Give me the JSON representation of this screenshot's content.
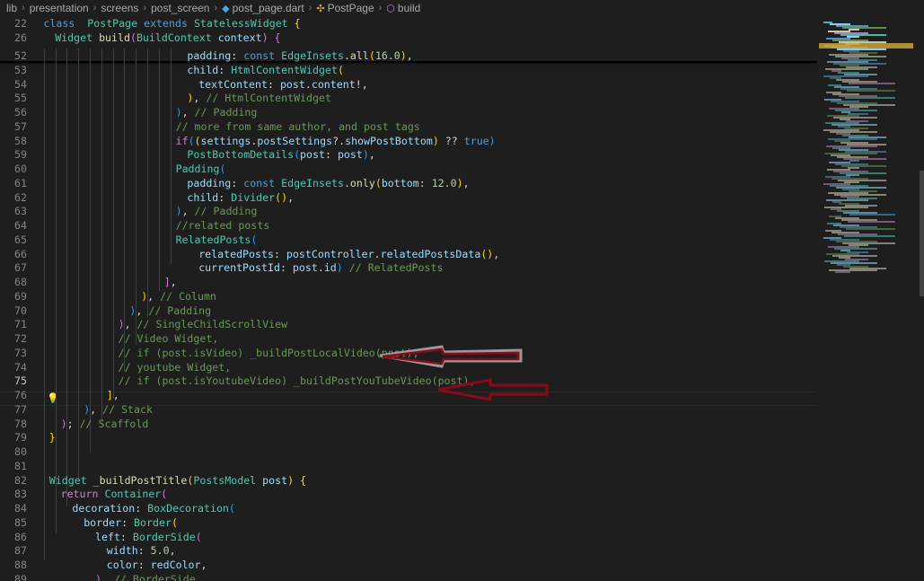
{
  "breadcrumb": {
    "items": [
      "lib",
      "presentation",
      "screens",
      "post_screen",
      "post_page.dart",
      "PostPage",
      "build"
    ]
  },
  "sticky_lines": [
    {
      "num": "22",
      "tokens": [
        [
          "kw",
          "class"
        ],
        [
          "",
          "  "
        ],
        [
          "cls",
          "PostPage"
        ],
        [
          "",
          " "
        ],
        [
          "kw",
          "extends"
        ],
        [
          "",
          " "
        ],
        [
          "cls",
          "StatelessWidget"
        ],
        [
          "",
          " "
        ],
        [
          "p1",
          "{"
        ]
      ]
    },
    {
      "num": "26",
      "tokens": [
        [
          "",
          ""
        ],
        [
          "cls",
          "Widget"
        ],
        [
          "",
          " "
        ],
        [
          "fn",
          "build"
        ],
        [
          "p2",
          "("
        ],
        [
          "cls",
          "BuildContext"
        ],
        [
          "",
          " "
        ],
        [
          "prop",
          "context"
        ],
        [
          "p2",
          ")"
        ],
        [
          "",
          " "
        ],
        [
          "p2",
          "{"
        ]
      ]
    }
  ],
  "lines": [
    {
      "num": "52",
      "indent": 13,
      "tokens": [
        [
          "prop",
          "padding"
        ],
        [
          "",
          ": "
        ],
        [
          "kw",
          "const"
        ],
        [
          "",
          " "
        ],
        [
          "cls",
          "EdgeInsets"
        ],
        [
          "",
          "."
        ],
        [
          "fn",
          "all"
        ],
        [
          "p1",
          "("
        ],
        [
          "num",
          "16.0"
        ],
        [
          "p1",
          ")"
        ],
        [
          "",
          ","
        ]
      ]
    },
    {
      "num": "53",
      "indent": 13,
      "tokens": [
        [
          "prop",
          "child"
        ],
        [
          "",
          ": "
        ],
        [
          "cls",
          "HtmlContentWidget"
        ],
        [
          "p1",
          "("
        ]
      ]
    },
    {
      "num": "54",
      "indent": 14,
      "tokens": [
        [
          "prop",
          "textContent"
        ],
        [
          "",
          ": "
        ],
        [
          "prop",
          "post"
        ],
        [
          "",
          "."
        ],
        [
          "prop",
          "content"
        ],
        [
          "",
          "!,"
        ]
      ]
    },
    {
      "num": "55",
      "indent": 13,
      "tokens": [
        [
          "p1",
          ")"
        ],
        [
          "",
          ", "
        ],
        [
          "cm",
          "// HtmlContentWidget"
        ]
      ]
    },
    {
      "num": "56",
      "indent": 12,
      "tokens": [
        [
          "p3",
          ")"
        ],
        [
          "",
          ", "
        ],
        [
          "cm",
          "// Padding"
        ]
      ]
    },
    {
      "num": "57",
      "indent": 12,
      "tokens": [
        [
          "cm",
          "// more from same author, and post tags"
        ]
      ]
    },
    {
      "num": "58",
      "indent": 12,
      "tokens": [
        [
          "ctl",
          "if"
        ],
        [
          "p3",
          "("
        ],
        [
          "p1",
          "("
        ],
        [
          "prop",
          "settings"
        ],
        [
          "",
          "."
        ],
        [
          "prop",
          "postSettings"
        ],
        [
          "",
          "?."
        ],
        [
          "prop",
          "showPostBottom"
        ],
        [
          "p1",
          ")"
        ],
        [
          "",
          " ?? "
        ],
        [
          "kw",
          "true"
        ],
        [
          "p3",
          ")"
        ]
      ]
    },
    {
      "num": "59",
      "indent": 13,
      "tokens": [
        [
          "cls",
          "PostBottomDetails"
        ],
        [
          "p3",
          "("
        ],
        [
          "prop",
          "post"
        ],
        [
          "",
          ": "
        ],
        [
          "prop",
          "post"
        ],
        [
          "p3",
          ")"
        ],
        [
          "",
          ","
        ]
      ]
    },
    {
      "num": "60",
      "indent": 12,
      "tokens": [
        [
          "cls",
          "Padding"
        ],
        [
          "p3",
          "("
        ]
      ]
    },
    {
      "num": "61",
      "indent": 13,
      "tokens": [
        [
          "prop",
          "padding"
        ],
        [
          "",
          ": "
        ],
        [
          "kw",
          "const"
        ],
        [
          "",
          " "
        ],
        [
          "cls",
          "EdgeInsets"
        ],
        [
          "",
          "."
        ],
        [
          "fn",
          "only"
        ],
        [
          "p1",
          "("
        ],
        [
          "prop",
          "bottom"
        ],
        [
          "",
          ": "
        ],
        [
          "num",
          "12.0"
        ],
        [
          "p1",
          ")"
        ],
        [
          "",
          ","
        ]
      ]
    },
    {
      "num": "62",
      "indent": 13,
      "tokens": [
        [
          "prop",
          "child"
        ],
        [
          "",
          ": "
        ],
        [
          "cls",
          "Divider"
        ],
        [
          "p1",
          "()"
        ],
        [
          "",
          ","
        ]
      ]
    },
    {
      "num": "63",
      "indent": 12,
      "tokens": [
        [
          "p3",
          ")"
        ],
        [
          "",
          ", "
        ],
        [
          "cm",
          "// Padding"
        ]
      ]
    },
    {
      "num": "64",
      "indent": 12,
      "tokens": [
        [
          "cm",
          "//related posts"
        ]
      ]
    },
    {
      "num": "65",
      "indent": 12,
      "tokens": [
        [
          "cls",
          "RelatedPosts"
        ],
        [
          "p3",
          "("
        ]
      ]
    },
    {
      "num": "66",
      "indent": 14,
      "tokens": [
        [
          "prop",
          "relatedPosts"
        ],
        [
          "",
          ": "
        ],
        [
          "prop",
          "postController"
        ],
        [
          "",
          "."
        ],
        [
          "prop",
          "relatedPostsData"
        ],
        [
          "p1",
          "()"
        ],
        [
          "",
          ","
        ]
      ]
    },
    {
      "num": "67",
      "indent": 14,
      "tokens": [
        [
          "prop",
          "currentPostId"
        ],
        [
          "",
          ": "
        ],
        [
          "prop",
          "post"
        ],
        [
          "",
          "."
        ],
        [
          "prop",
          "id"
        ],
        [
          "p3",
          ")"
        ],
        [
          "",
          " "
        ],
        [
          "cm",
          "// RelatedPosts"
        ]
      ]
    },
    {
      "num": "68",
      "indent": 11,
      "tokens": [
        [
          "p2",
          "]"
        ],
        [
          "",
          ","
        ]
      ]
    },
    {
      "num": "69",
      "indent": 9,
      "tokens": [
        [
          "p1",
          ")"
        ],
        [
          "",
          ", "
        ],
        [
          "cm",
          "// Column"
        ]
      ]
    },
    {
      "num": "70",
      "indent": 8,
      "tokens": [
        [
          "p3",
          ")"
        ],
        [
          "",
          ", "
        ],
        [
          "cm",
          "// Padding"
        ]
      ]
    },
    {
      "num": "71",
      "indent": 7,
      "tokens": [
        [
          "p2",
          ")"
        ],
        [
          "",
          ", "
        ],
        [
          "cm",
          "// SingleChildScrollView"
        ]
      ]
    },
    {
      "num": "72",
      "indent": 7,
      "tokens": [
        [
          "cm",
          "// Video Widget,"
        ]
      ]
    },
    {
      "num": "73",
      "indent": 7,
      "tokens": [
        [
          "cm",
          "// if (post.isVideo) _buildPostLocalVideo(post),"
        ]
      ]
    },
    {
      "num": "74",
      "indent": 7,
      "tokens": [
        [
          "cm",
          "// youtube Widget,"
        ]
      ]
    },
    {
      "num": "75",
      "indent": 7,
      "tokens": [
        [
          "cm",
          "// if (post.isYoutubeVideo) _buildPostYouTubeVideo(post),"
        ]
      ],
      "active": true
    },
    {
      "num": "76",
      "indent": 6,
      "tokens": [
        [
          "p1",
          "]"
        ],
        [
          "",
          ","
        ]
      ]
    },
    {
      "num": "77",
      "indent": 4,
      "tokens": [
        [
          "p3",
          ")"
        ],
        [
          "",
          ", "
        ],
        [
          "cm",
          "// Stack"
        ]
      ]
    },
    {
      "num": "78",
      "indent": 2,
      "tokens": [
        [
          "p2",
          ")"
        ],
        [
          "",
          "; "
        ],
        [
          "cm",
          "// Scaffold"
        ]
      ]
    },
    {
      "num": "79",
      "indent": 1,
      "tokens": [
        [
          "p1",
          "}"
        ]
      ]
    },
    {
      "num": "80",
      "indent": 0,
      "tokens": []
    },
    {
      "num": "81",
      "indent": 0,
      "tokens": []
    },
    {
      "num": "82",
      "indent": 1,
      "tokens": [
        [
          "cls",
          "Widget"
        ],
        [
          "",
          " "
        ],
        [
          "fn",
          "_buildPostTitle"
        ],
        [
          "p1",
          "("
        ],
        [
          "cls",
          "PostsModel"
        ],
        [
          "",
          " "
        ],
        [
          "prop",
          "post"
        ],
        [
          "p1",
          ")"
        ],
        [
          "",
          " "
        ],
        [
          "p1",
          "{"
        ]
      ]
    },
    {
      "num": "83",
      "indent": 2,
      "tokens": [
        [
          "ctl",
          "return"
        ],
        [
          "",
          " "
        ],
        [
          "cls",
          "Container"
        ],
        [
          "p2",
          "("
        ]
      ]
    },
    {
      "num": "84",
      "indent": 3,
      "tokens": [
        [
          "prop",
          "decoration"
        ],
        [
          "",
          ": "
        ],
        [
          "cls",
          "BoxDecoration"
        ],
        [
          "p3",
          "("
        ]
      ]
    },
    {
      "num": "85",
      "indent": 4,
      "tokens": [
        [
          "prop",
          "border"
        ],
        [
          "",
          ": "
        ],
        [
          "cls",
          "Border"
        ],
        [
          "p1",
          "("
        ]
      ]
    },
    {
      "num": "86",
      "indent": 5,
      "tokens": [
        [
          "prop",
          "left"
        ],
        [
          "",
          ": "
        ],
        [
          "cls",
          "BorderSide"
        ],
        [
          "p2",
          "("
        ]
      ]
    },
    {
      "num": "87",
      "indent": 6,
      "tokens": [
        [
          "prop",
          "width"
        ],
        [
          "",
          ": "
        ],
        [
          "num",
          "5.0"
        ],
        [
          "",
          ","
        ]
      ]
    },
    {
      "num": "88",
      "indent": 6,
      "tokens": [
        [
          "prop",
          "color"
        ],
        [
          "",
          ": "
        ],
        [
          "prop",
          "redColor"
        ],
        [
          "",
          ","
        ]
      ]
    },
    {
      "num": "89",
      "indent": 5,
      "tokens": [
        [
          "p2",
          ")"
        ],
        [
          "",
          ", "
        ],
        [
          "cm",
          "// BorderSide"
        ]
      ]
    }
  ],
  "colors": {
    "background": "#1e1e1e",
    "arrow_stroke": "#8b0a1a",
    "arrow_gray": "#9a9a9a"
  }
}
